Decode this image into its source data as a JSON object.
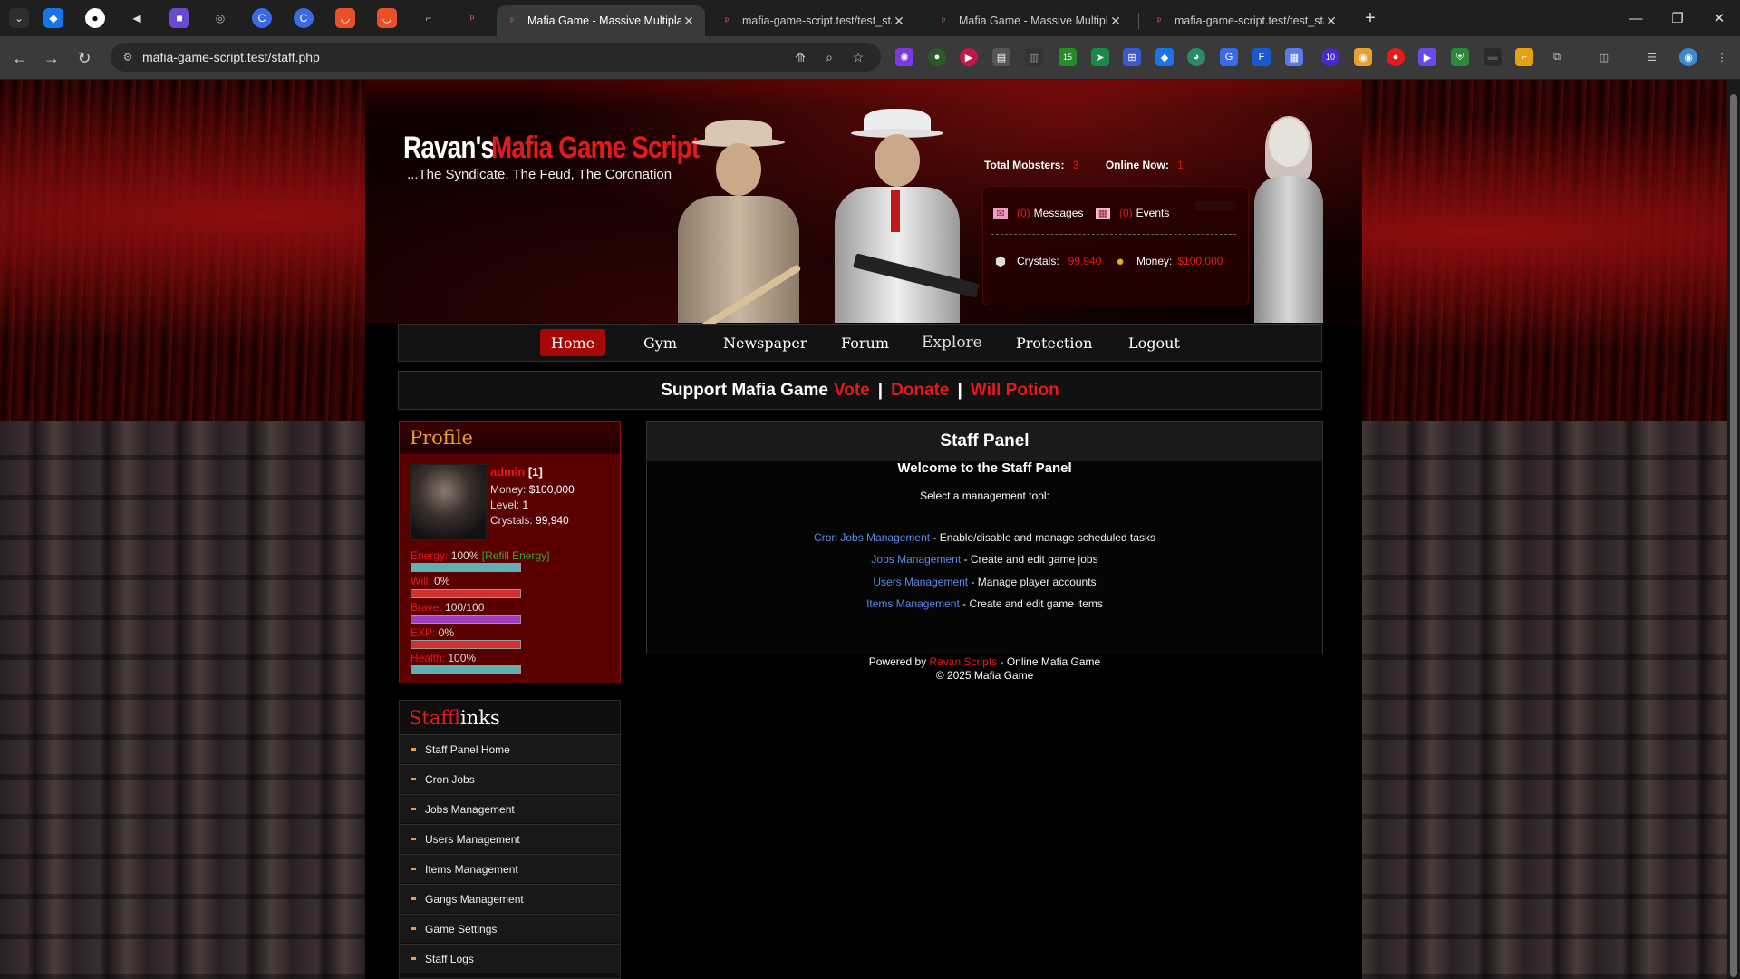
{
  "browser": {
    "tabs": [
      {
        "title": "Mafia Game - Massive Multiplay",
        "active": true
      },
      {
        "title": "mafia-game-script.test/test_sta",
        "active": false
      },
      {
        "title": "Mafia Game - Massive Multiplay",
        "active": false
      },
      {
        "title": "mafia-game-script.test/test_sta",
        "active": false
      }
    ],
    "url": "mafia-game-script.test/staff.php",
    "extension_badges": {
      "first": "15",
      "second": "10"
    }
  },
  "header": {
    "logo_prefix": "Ravan's",
    "logo_main": "Mafia Game Script",
    "tagline": "...The Syndicate, The Feud, The Coronation",
    "total_mobsters_label": "Total Mobsters:",
    "total_mobsters": "3",
    "online_now_label": "Online Now:",
    "online_now": "1",
    "messages_count": "(0)",
    "messages_label": "Messages",
    "events_count": "(0)",
    "events_label": "Events",
    "crystals_label": "Crystals:",
    "crystals": "99,940",
    "money_label": "Money:",
    "money": "$100,000"
  },
  "nav": {
    "items": [
      "Home",
      "Gym",
      "Newspaper",
      "Forum",
      "Explore",
      "Protection",
      "Logout"
    ]
  },
  "support": {
    "prefix": "Support Mafia Game",
    "vote": "Vote",
    "donate": "Donate",
    "will_potion": "Will Potion",
    "separator": "|"
  },
  "profile": {
    "title": "Profile",
    "name": "admin",
    "id": "[1]",
    "money_label": "Money:",
    "money": "$100,000",
    "level_label": "Level:",
    "level": "1",
    "crystals_label": "Crystals:",
    "crystals": "99,940",
    "energy_label": "Energy:",
    "energy_value": "100%",
    "refill_label": "[Refill Energy]",
    "will_label": "Will:",
    "will_value": "0%",
    "brave_label": "Brave:",
    "brave_value": "100/100",
    "exp_label": "EXP:",
    "exp_value": "0%",
    "health_label": "Health:",
    "health_value": "100%",
    "bars": {
      "energy": {
        "fraction": 1.0,
        "color": "#5fb0b0"
      },
      "will": {
        "fraction": 1.0,
        "color": "#d03030"
      },
      "brave": {
        "fraction": 1.0,
        "color": "#a040c0"
      },
      "exp": {
        "fraction": 1.0,
        "color": "#d03030"
      },
      "health": {
        "fraction": 1.0,
        "color": "#5fb0b0"
      }
    }
  },
  "staff_links": {
    "title_a": "Staff",
    "title_b": "links",
    "items": [
      "Staff Panel Home",
      "Cron Jobs",
      "Jobs Management",
      "Users Management",
      "Items Management",
      "Gangs Management",
      "Game Settings",
      "Staff Logs"
    ]
  },
  "panel": {
    "title": "Staff Panel",
    "welcome": "Welcome to the Staff Panel",
    "select": "Select a management tool:",
    "tools": [
      {
        "link": "Cron Jobs Management",
        "desc": " - Enable/disable and manage scheduled tasks"
      },
      {
        "link": "Jobs Management",
        "desc": " - Create and edit game jobs"
      },
      {
        "link": "Users Management",
        "desc": " - Manage player accounts"
      },
      {
        "link": "Items Management",
        "desc": " - Create and edit game items"
      }
    ]
  },
  "footer": {
    "powered_by": "Powered by",
    "brand": "Ravan Scripts",
    "suffix": "- Online Mafia Game",
    "copyright": "© 2025 Mafia Game"
  },
  "colors": {
    "accent_red": "#e21a1a",
    "link_blue": "#5a8ae6",
    "profile_orange": "#e8a030"
  }
}
